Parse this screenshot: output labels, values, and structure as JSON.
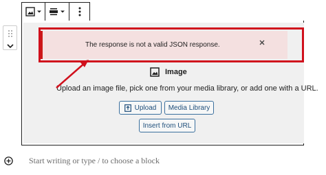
{
  "toolbar": {
    "items": [
      {
        "icon": "image-icon"
      },
      {
        "icon": "chevron-down-icon"
      },
      {
        "icon": "align-center-icon"
      },
      {
        "icon": "chevron-down-icon"
      },
      {
        "icon": "more-vertical-icon"
      }
    ]
  },
  "mover": {
    "drag_icon": "drag-handle-icon",
    "down_icon": "chevron-down-icon"
  },
  "notice": {
    "message": "The response is not a valid JSON response.",
    "close_icon": "close-icon",
    "status_color": "#cc1818"
  },
  "placeholder": {
    "label": "Image",
    "instructions": "Upload an image file, pick one from your media library, or add one with a URL.",
    "upload_label": "Upload",
    "media_library_label": "Media Library",
    "insert_url_label": "Insert from URL"
  },
  "appender": {
    "text": "Start writing or type / to choose a block",
    "icon": "plus-circle-icon"
  },
  "annotation": {
    "color": "#d0101c"
  }
}
